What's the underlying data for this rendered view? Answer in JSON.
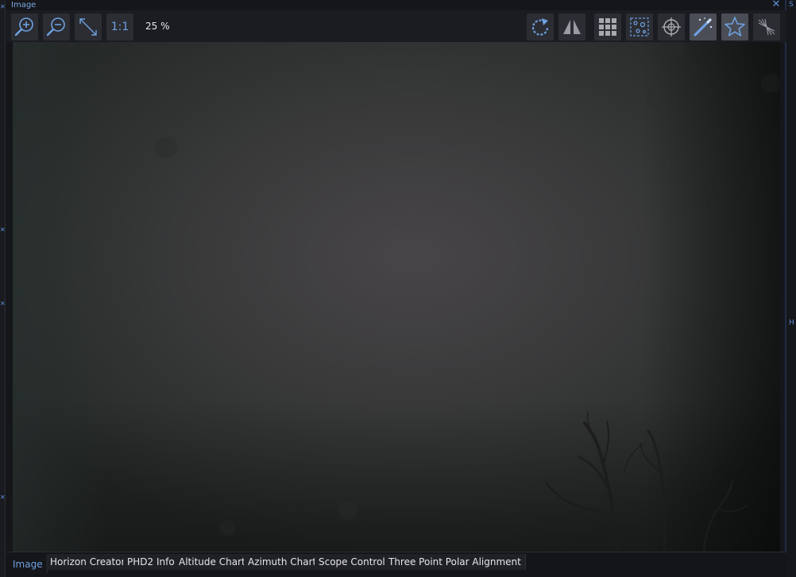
{
  "window": {
    "title": "Image",
    "close_glyph": "✕"
  },
  "toolbar": {
    "zoom_level": "25 %",
    "one_to_one_label": "1:1",
    "buttons": [
      {
        "icon": "zoom-in-icon",
        "active": false
      },
      {
        "icon": "zoom-out-icon",
        "active": false
      },
      {
        "icon": "fit-to-screen-icon",
        "active": false
      },
      {
        "icon": "one-to-one-icon",
        "active": false
      },
      {
        "icon": "rotate-icon",
        "active": false
      },
      {
        "icon": "flip-icon",
        "active": false
      },
      {
        "icon": "grid-icon",
        "active": false
      },
      {
        "icon": "plate-solve-icon",
        "active": false
      },
      {
        "icon": "crosshair-icon",
        "active": false
      },
      {
        "icon": "auto-stretch-icon",
        "active": true
      },
      {
        "icon": "detect-stars-icon",
        "active": true
      },
      {
        "icon": "bahtinov-icon",
        "active": false
      }
    ]
  },
  "tabs": [
    {
      "label": "Image",
      "selected": true
    },
    {
      "label": "Horizon Creator",
      "selected": false
    },
    {
      "label": "PHD2 Info",
      "selected": false
    },
    {
      "label": "Altitude Chart",
      "selected": false
    },
    {
      "label": "Azimuth Chart",
      "selected": false
    },
    {
      "label": "Scope Control",
      "selected": false
    },
    {
      "label": "Three Point Polar Alignment",
      "selected": false
    }
  ],
  "side_fragments": {
    "right_top": "S",
    "right_mid": "H"
  },
  "colors": {
    "accent": "#5b8fd8",
    "toolbar_button": "#2b2d33",
    "toolbar_button_active": "#4a4d56",
    "panel_background": "#15161a"
  }
}
